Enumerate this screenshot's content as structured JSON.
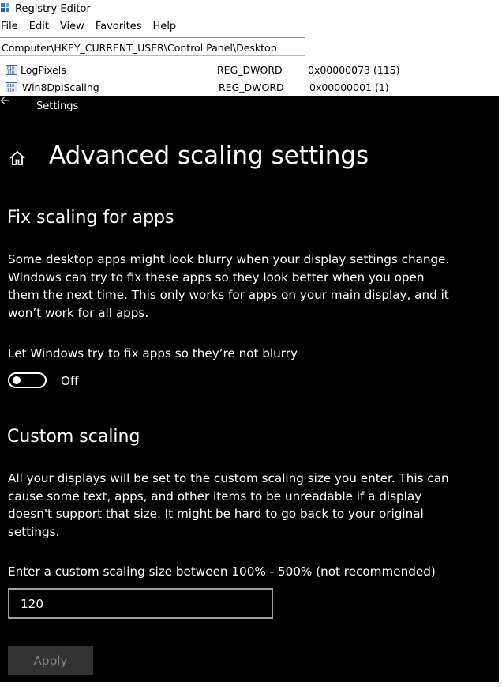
{
  "registry": {
    "title": "Registry Editor",
    "menu": [
      "File",
      "Edit",
      "View",
      "Favorites",
      "Help"
    ],
    "address": "Computer\\HKEY_CURRENT_USER\\Control Panel\\Desktop",
    "rows": [
      {
        "name": "LogPixels",
        "type": "REG_DWORD",
        "data": "0x00000073 (115)"
      },
      {
        "name": "Win8DpiScaling",
        "type": "REG_DWORD",
        "data": "0x00000001 (1)"
      }
    ]
  },
  "settings": {
    "window_label": "Settings",
    "page_title": "Advanced scaling settings",
    "fix": {
      "heading": "Fix scaling for apps",
      "description": "Some desktop apps might look blurry when your display settings change. Windows can try to fix these apps so they look better when you open them the next time. This only works for apps on your main display, and it won’t work for all apps.",
      "toggle_label": "Let Windows try to fix apps so they’re not blurry",
      "toggle_state": "Off"
    },
    "custom": {
      "heading": "Custom scaling",
      "description": "All your displays will be set to the custom scaling size you enter. This can cause some text, apps, and other items to be unreadable if a display doesn't support that size. It might be hard to go back to your original settings.",
      "entry_label": "Enter a custom scaling size between 100% - 500% (not recommended)",
      "entry_value": "120",
      "apply_label": "Apply"
    }
  },
  "icons": {
    "registry_app": "registry-icon",
    "value_entry": "binary-value-icon",
    "back": "back-arrow-icon",
    "home": "home-icon"
  },
  "colors": {
    "settings_bg": "#000000",
    "text": "#ffffff",
    "button_bg": "#333333",
    "button_text": "#838383",
    "input_border": "#a0a0a0"
  }
}
